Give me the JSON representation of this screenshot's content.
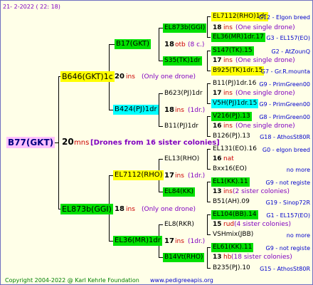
{
  "header": {
    "date": "21- 2-2022 ( 22: 18)"
  },
  "footer": {
    "copyright": "Copyright 2004-2022 @ Karl Kehrle Foundation",
    "url": "www.pedigreeapis.org"
  },
  "colors": {
    "violet": "#ffc0ff",
    "yellow": "#ffff00",
    "green": "#00e000",
    "cyan": "#00ffff",
    "red": "#cc0000",
    "purple": "#8000c0",
    "blue": "#0000cc"
  },
  "root": {
    "name": "B77(GKT)",
    "num": "20",
    "unit": "mns",
    "note": "[Drones from 16 sister colonies]"
  },
  "gen1": [
    {
      "name": "B646(GKT)1c",
      "num": "20",
      "unit": "ins",
      "note": "(Only one drone)"
    },
    {
      "name": "EL873b(GGI)",
      "num": "18",
      "unit": "ins",
      "note": "(Only one drone)"
    }
  ],
  "gen2": [
    {
      "name": "B17(GKT)",
      "num": "18",
      "unit": "otb",
      "note": "(8 c.)"
    },
    {
      "name": "B424(PJ)1dr",
      "num": "18",
      "unit": "ins",
      "note": "(1dr.)"
    },
    {
      "name": "EL7112(RHO)",
      "num": "17",
      "unit": "ins",
      "note": "(1dr.)"
    },
    {
      "name": "EL36(MR)1dr",
      "num": "17",
      "unit": "ins",
      "note": "(1dr.)"
    }
  ],
  "gen3": [
    {
      "name": "EL873b(GGI)"
    },
    {
      "name": "S35(TK)1dr"
    },
    {
      "name": "B623(PJ)1dr"
    },
    {
      "name": "B11(PJ)1dr"
    },
    {
      "name": "EL13(RHO)"
    },
    {
      "name": "EL84(KK)"
    },
    {
      "name": "EL8(RKR)"
    },
    {
      "name": "B14Vt(RHO)"
    }
  ],
  "gen3_info": [
    {
      "num": "18",
      "unit": "ins",
      "note": "(One single drone)"
    },
    {
      "num": "17",
      "unit": "ins",
      "note": "(One single drone)"
    },
    {
      "num": "17",
      "unit": "ins",
      "note": "(One single drone)"
    },
    {
      "num": "16",
      "unit": "ins",
      "note": "(One single drone)"
    },
    {
      "num": "16",
      "unit": "nat",
      "note": ""
    },
    {
      "num": "13",
      "unit": "ins",
      "note": "(2 sister colonies)"
    },
    {
      "num": "15",
      "unit": "rud",
      "note": "(4 sister colonies)"
    },
    {
      "num": "13",
      "unit": "hb",
      "note": "(18 sister colonies)"
    }
  ],
  "gen4": [
    {
      "name": "EL7112(RHO)1dr",
      "cid": "G12 - Elgon breed"
    },
    {
      "name": "EL36(MR)1dr.17",
      "cid": "G3 - EL157(EO)"
    },
    {
      "name": "S147(TK).15",
      "cid": "G2 - AtZounQ"
    },
    {
      "name": "B925(TK)1dr.15",
      "cid": "G7 - Gr.R.mounta"
    },
    {
      "name": "B11(PJ)1dr.16",
      "cid": "G9 - PrimGreen00"
    },
    {
      "name": "V5H(PJ)1dr.15",
      "cid": "G9 - PrimGreen00"
    },
    {
      "name": "V216(PJ).13",
      "cid": "G8 - PrimGreen00"
    },
    {
      "name": "B126(PJ).13",
      "cid": "G18 - AthosSt80R"
    },
    {
      "name": "EL131(EO).16",
      "cid": "G0 - elgon breed"
    },
    {
      "name": "Bxx16(EO)",
      "cid": "no more"
    },
    {
      "name": "EL1(KK).11",
      "cid": "G9 - not registe"
    },
    {
      "name": "B51(AH).09",
      "cid": "G19 - Sinop72R"
    },
    {
      "name": "EL104(BB).14",
      "cid": "G1 - EL157(EO)"
    },
    {
      "name": "VSHmix(JBB)",
      "cid": "no more"
    },
    {
      "name": "EL61(KK).11",
      "cid": "G9 - not registe"
    },
    {
      "name": "B235(PJ).10",
      "cid": "G15 - AthosSt80R"
    }
  ]
}
